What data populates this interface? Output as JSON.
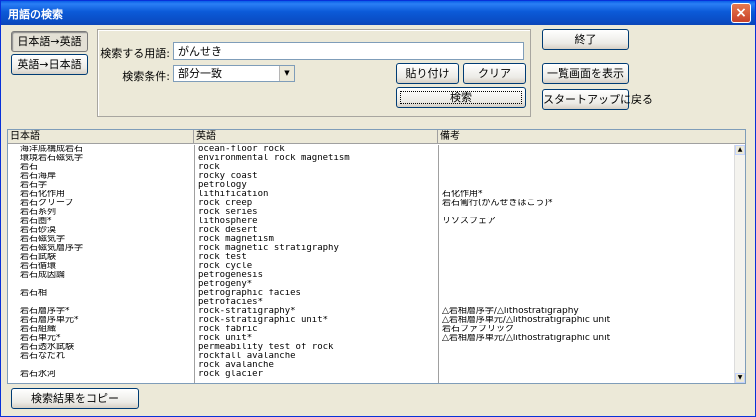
{
  "window": {
    "title": "用語の検索",
    "close_label": "×"
  },
  "mode_buttons": {
    "ja_to_en": "日本語→英語",
    "en_to_ja": "英語→日本語"
  },
  "search": {
    "term_label": "検索する用語:",
    "term_value": "がんせき",
    "condition_label": "検索条件:",
    "condition_value": "部分一致",
    "paste_label": "貼り付け",
    "clear_label": "クリア",
    "search_label": "検索"
  },
  "right_buttons": {
    "exit": "終了",
    "list_view": "一覧画面を表示",
    "startup": "スタートアップに戻る"
  },
  "table": {
    "headers": [
      "日本語",
      "英語",
      "備考"
    ],
    "rows": [
      [
        "海洋底構成岩石",
        "ocean-floor rock",
        ""
      ],
      [
        "環境岩石磁気学",
        "environmental rock magnetism",
        ""
      ],
      [
        "岩石",
        "rock",
        ""
      ],
      [
        "岩石海岸",
        "rocky coast",
        ""
      ],
      [
        "岩石学",
        "petrology",
        ""
      ],
      [
        "岩石化作用",
        "lithification",
        "石化作用*"
      ],
      [
        "岩石クリープ",
        "rock creep",
        "岩石匍行(がんせきほこう)*"
      ],
      [
        "岩石系列",
        "rock series",
        ""
      ],
      [
        "岩石圏*",
        "lithosphere",
        "リソスフェア"
      ],
      [
        "岩石砂漠",
        "rock desert",
        ""
      ],
      [
        "岩石磁気学",
        "rock magnetism",
        ""
      ],
      [
        "岩石磁気層序学",
        "rock magnetic stratigraphy",
        ""
      ],
      [
        "岩石試験",
        "rock test",
        ""
      ],
      [
        "岩石循環",
        "rock cycle",
        ""
      ],
      [
        "岩石成因論",
        "petrogenesis",
        ""
      ],
      [
        "",
        "petrogeny*",
        ""
      ],
      [
        "岩石相",
        "petrographic facies",
        ""
      ],
      [
        "",
        "petrofacies*",
        ""
      ],
      [
        "岩石層序学*",
        "rock-stratigraphy*",
        "△岩相層序学/△lithostratigraphy"
      ],
      [
        "岩石層序単元*",
        "rock-stratigraphic unit*",
        "△岩相層序単元/△lithostratigraphic unit"
      ],
      [
        "岩石組織",
        "rock fabric",
        "岩石ファブリック"
      ],
      [
        "岩石単元*",
        "rock unit*",
        "△岩相層序単元/△lithostratigraphic unit"
      ],
      [
        "岩石透水試験",
        "permeability test of rock",
        ""
      ],
      [
        "岩石なだれ",
        "rockfall avalanche",
        ""
      ],
      [
        "",
        "rock avalanche",
        ""
      ],
      [
        "岩石氷河",
        "rock glacier",
        ""
      ]
    ]
  },
  "copy_button": "検索結果をコピー"
}
